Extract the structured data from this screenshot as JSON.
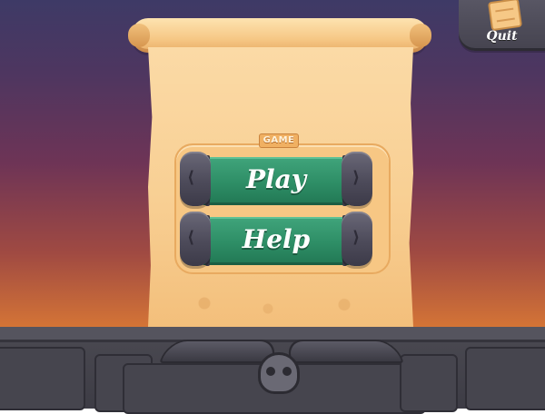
{
  "menu": {
    "section_label": "GAME",
    "buttons": [
      {
        "label": "Play"
      },
      {
        "label": "Help"
      }
    ]
  },
  "corner": {
    "quit_label": "Quit",
    "icon": "scroll-icon"
  },
  "decor": {
    "emblem_icon": "skull-icon",
    "accent_green": "#2e8e66",
    "parchment": "#f8cf93"
  }
}
